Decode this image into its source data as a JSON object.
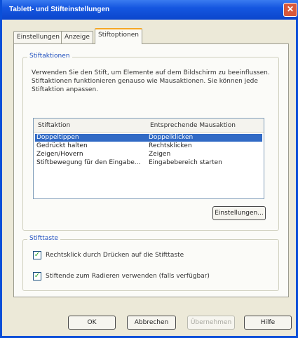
{
  "window": {
    "title": "Tablett- und Stifteinstellungen",
    "close_glyph": "✕"
  },
  "tabs": [
    {
      "label": "Einstellungen"
    },
    {
      "label": "Anzeige"
    },
    {
      "label": "Stiftoptionen"
    }
  ],
  "stiftaktionen": {
    "legend": "Stiftaktionen",
    "description": "Verwenden Sie den Stift, um Elemente auf dem Bildschirm zu beeinflussen. Stiftaktionen funktionieren genauso wie Mausaktionen. Sie können jede Stiftaktion anpassen.",
    "columns": [
      "Stiftaktion",
      "Entsprechende Mausaktion"
    ],
    "rows": [
      [
        "Doppeltippen",
        "Doppelklicken"
      ],
      [
        "Gedrückt halten",
        "Rechtsklicken"
      ],
      [
        "Zeigen/Hovern",
        "Zeigen"
      ],
      [
        "Stiftbewegung für den Eingabe...",
        "Eingabebereich starten"
      ]
    ],
    "settings_button": "Einstellungen..."
  },
  "stifttaste": {
    "legend": "Stifttaste",
    "checkboxes": [
      {
        "label": "Rechtsklick durch Drücken auf die Stifttaste"
      },
      {
        "label": "Stiftende zum Radieren verwenden (falls verfügbar)"
      }
    ]
  },
  "buttons": {
    "ok": "OK",
    "cancel": "Abbrechen",
    "apply": "Übernehmen",
    "help": "Hilfe"
  },
  "check_glyph": "✓"
}
